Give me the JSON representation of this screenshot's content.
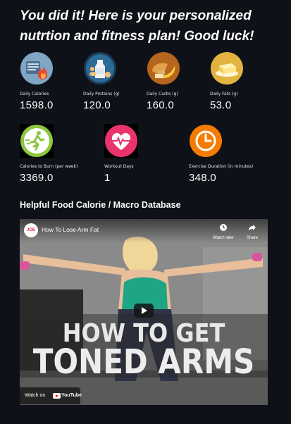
{
  "header": {
    "title": "You did it! Here is your personalized nutrtion and fitness plan! Good luck!"
  },
  "metrics_row1": [
    {
      "label": "Daily Calories",
      "value": "1598.0",
      "icon": "calorie-fire-icon"
    },
    {
      "label": "Daily Proteins (g)",
      "value": "120.0",
      "icon": "protein-milk-icon"
    },
    {
      "label": "Daily Carbs (g)",
      "value": "160.0",
      "icon": "carbs-bread-icon"
    },
    {
      "label": "Daily Fats (g)",
      "value": "53.0",
      "icon": "butter-icon"
    }
  ],
  "metrics_row2": [
    {
      "label": "Calories to Burn (per week)",
      "value": "3369.0",
      "icon": "runner-icon"
    },
    {
      "label": "Workout Days",
      "value": "1",
      "icon": "heart-pulse-icon"
    },
    {
      "label": "Exercise Duration (in minutes)",
      "value": "348.0",
      "icon": "clock-icon"
    }
  ],
  "section": {
    "title": "Helpful Food Calorie / Macro Database"
  },
  "video": {
    "title": "How To Lose Arm Fat",
    "channel_badge": "JOE",
    "watch_later": "Watch later",
    "share": "Share",
    "overlay_line1": "HOW TO GET",
    "overlay_line2": "TONED ARMS",
    "watch_on": "Watch on",
    "youtube": "YouTube"
  },
  "colors": {
    "background": "#0e1117",
    "calorie_icon_bg": "#7fa6c4",
    "protein_icon_bg": "#2d6c96",
    "carbs_icon_bg": "#b5651d",
    "fats_icon_bg": "#e3b341",
    "runner_icon": "#8dc63f",
    "heart_icon": "#e8336d",
    "clock_icon": "#f57c00"
  }
}
